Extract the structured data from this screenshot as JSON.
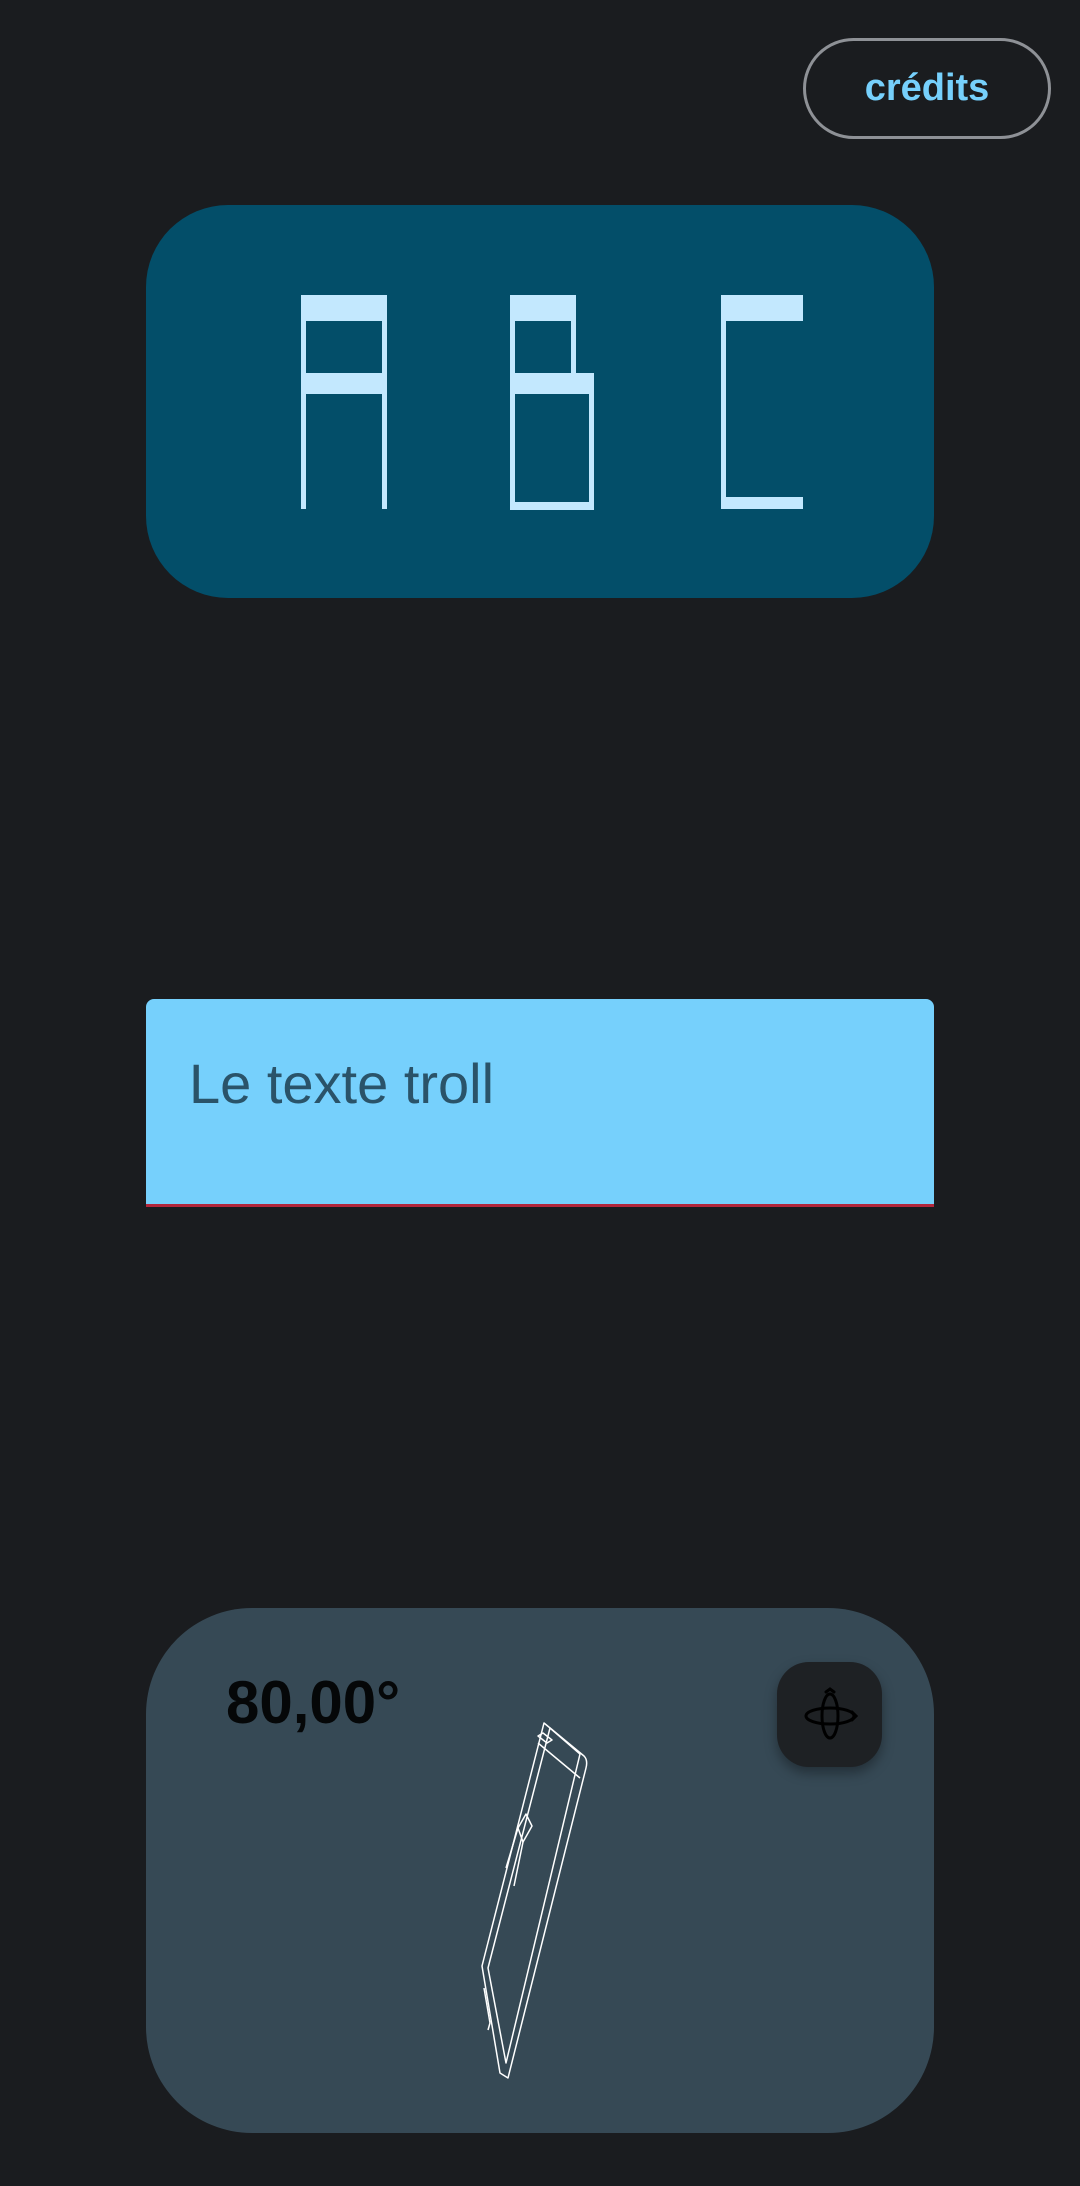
{
  "header": {
    "credits_label": "crédits"
  },
  "letters_card": {
    "letters": [
      "A",
      "B",
      "C"
    ]
  },
  "text_field": {
    "value": "Le texte troll"
  },
  "tilt_card": {
    "angle_readout": "80,00°",
    "orientation_button_icon": "3d-rotation-icon",
    "illustration_icon": "tilted-phone-icon"
  },
  "colors": {
    "background": "#1a1c1f",
    "accent": "#76d0fc",
    "letters_card_bg": "#034e69",
    "letters_fill": "#c3e8fe",
    "text_field_bg": "#76d0fc",
    "text_field_underline": "#b3263b",
    "tilt_card_bg": "#364955",
    "orientation_button_bg": "#1e2124"
  }
}
